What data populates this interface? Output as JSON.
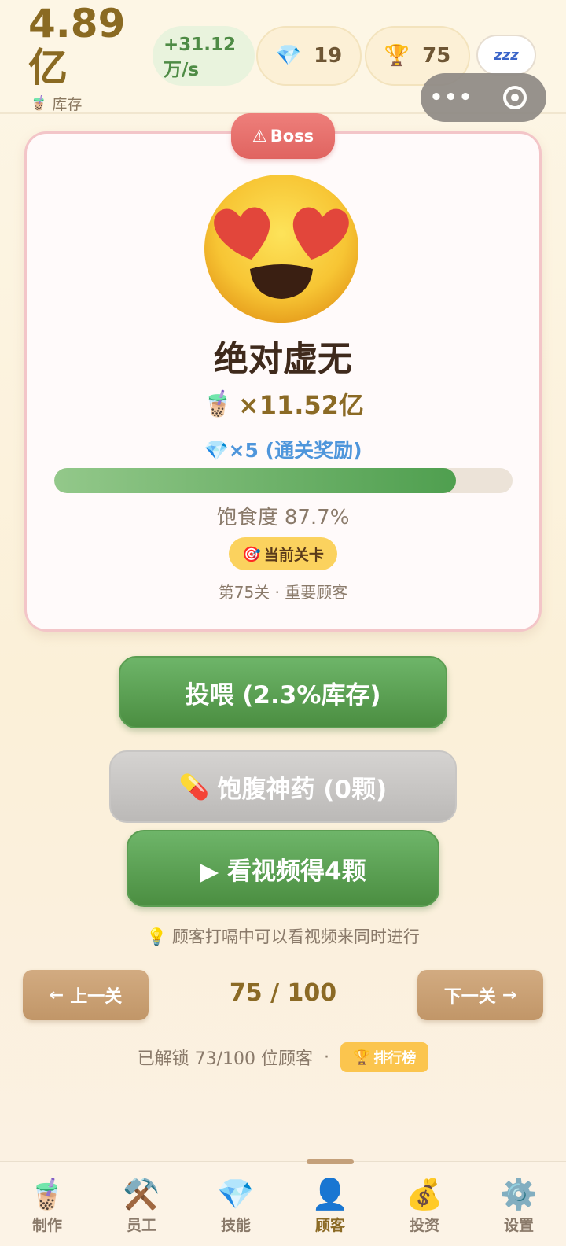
{
  "header": {
    "stock_value": "4.89亿",
    "stock_label": "库存",
    "rate": "+31.12万/s",
    "gems": "19",
    "trophies": "75",
    "sleep_label": "zzz"
  },
  "boss": {
    "tag": "Boss",
    "emoji_name": "smiling-face-with-heart-eyes",
    "name": "绝对虚无",
    "hunger_value": "×11.52亿",
    "reward": "×5 (通关奖励)",
    "satiety_fraction": 0.877,
    "satiety_label": "饱食度 87.7%",
    "current_badge": "当前关卡",
    "level_info": "第75关 · 重要顾客"
  },
  "actions": {
    "feed_label": "投喂 (2.3%库存)",
    "pill_label": "饱腹神药 (0颗)",
    "video_label": "▶ 看视频得4颗",
    "tip": "顾客打嗝中可以看视频来同时进行"
  },
  "level_nav": {
    "prev_label": "上一关",
    "next_label": "下一关",
    "count": "75 / 100",
    "unlocked": "已解锁 73/100 位顾客",
    "separator": "·",
    "rank_label": "排行榜"
  },
  "tabbar": {
    "items": [
      {
        "label": "制作",
        "icon": "🧋"
      },
      {
        "label": "员工",
        "icon": "⚒️"
      },
      {
        "label": "技能",
        "icon": "💎"
      },
      {
        "label": "顾客",
        "icon": "👤"
      },
      {
        "label": "投资",
        "icon": "💰"
      },
      {
        "label": "设置",
        "icon": "⚙️"
      }
    ],
    "active_index": 3
  },
  "colors": {
    "accent_brown": "#8b6a25",
    "green_button": "#4b8e41",
    "boss_red": "#e06460",
    "gem_blue": "#4f96db"
  }
}
